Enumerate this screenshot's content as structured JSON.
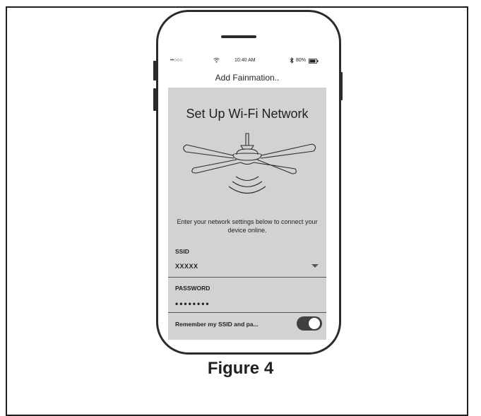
{
  "status": {
    "carrier": "••○○○",
    "time": "10:40 AM",
    "battery_pct": "80%"
  },
  "nav_title": "Add Fainmation..",
  "headline": "Set Up Wi-Fi Network",
  "instructions": "Enter your network settings below to connect your device online.",
  "ssid": {
    "label": "SSID",
    "value": "XXXXX"
  },
  "password": {
    "label": "PASSWORD",
    "value": "••••••••"
  },
  "remember": {
    "label": "Remember my SSID and pa...",
    "enabled": true
  },
  "caption": "Figure 4",
  "icons": [
    "wifi-icon",
    "bluetooth-icon",
    "battery-icon",
    "ceiling-fan-icon",
    "signal-waves-icon",
    "chevron-down-icon"
  ]
}
